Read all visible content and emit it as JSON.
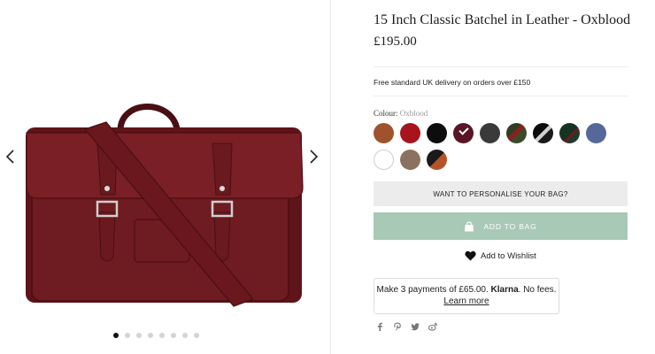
{
  "product": {
    "title": "15 Inch Classic Batchel in Leather - Oxblood",
    "price": "£195.00",
    "delivery_note": "Free standard UK delivery on orders over £150"
  },
  "colour": {
    "label": "Colour:",
    "selected": "Oxblood",
    "swatches": [
      {
        "name": "tan-brown",
        "color": "#a0522d"
      },
      {
        "name": "red",
        "color": "#a8141c"
      },
      {
        "name": "black",
        "color": "#0d0d0d"
      },
      {
        "name": "oxblood",
        "color": "#5a1526",
        "selected": true
      },
      {
        "name": "dark-grey",
        "color": "#3a3a3a"
      },
      {
        "name": "green-red-stripe",
        "color": "#4a3a22"
      },
      {
        "name": "black-metallic",
        "color": "#1a1a1a"
      },
      {
        "name": "green-tartan",
        "color": "#1f3b2a"
      },
      {
        "name": "blue",
        "color": "#56679a"
      },
      {
        "name": "white",
        "color": "#ffffff"
      },
      {
        "name": "taupe",
        "color": "#8b7260"
      },
      {
        "name": "black-tan",
        "color": "#2a2a2a"
      }
    ]
  },
  "actions": {
    "personalise_label": "WANT TO PERSONALISE YOUR BAG?",
    "add_to_bag_label": "ADD TO BAG",
    "wishlist_label": "Add to Wishlist"
  },
  "klarna": {
    "text_before": "Make 3 payments of £65.00.",
    "brand": "Klarna",
    "text_after": ". No fees.",
    "link": "Learn more"
  },
  "gallery": {
    "dot_count": 8,
    "active_index": 0
  },
  "theme": {
    "accent": "#a8c9b5",
    "product_color": "#6b1a1f"
  },
  "icons": [
    "chevron-left-icon",
    "chevron-right-icon",
    "bag-icon",
    "heart-icon",
    "facebook-icon",
    "pinterest-icon",
    "twitter-icon",
    "weibo-icon"
  ]
}
